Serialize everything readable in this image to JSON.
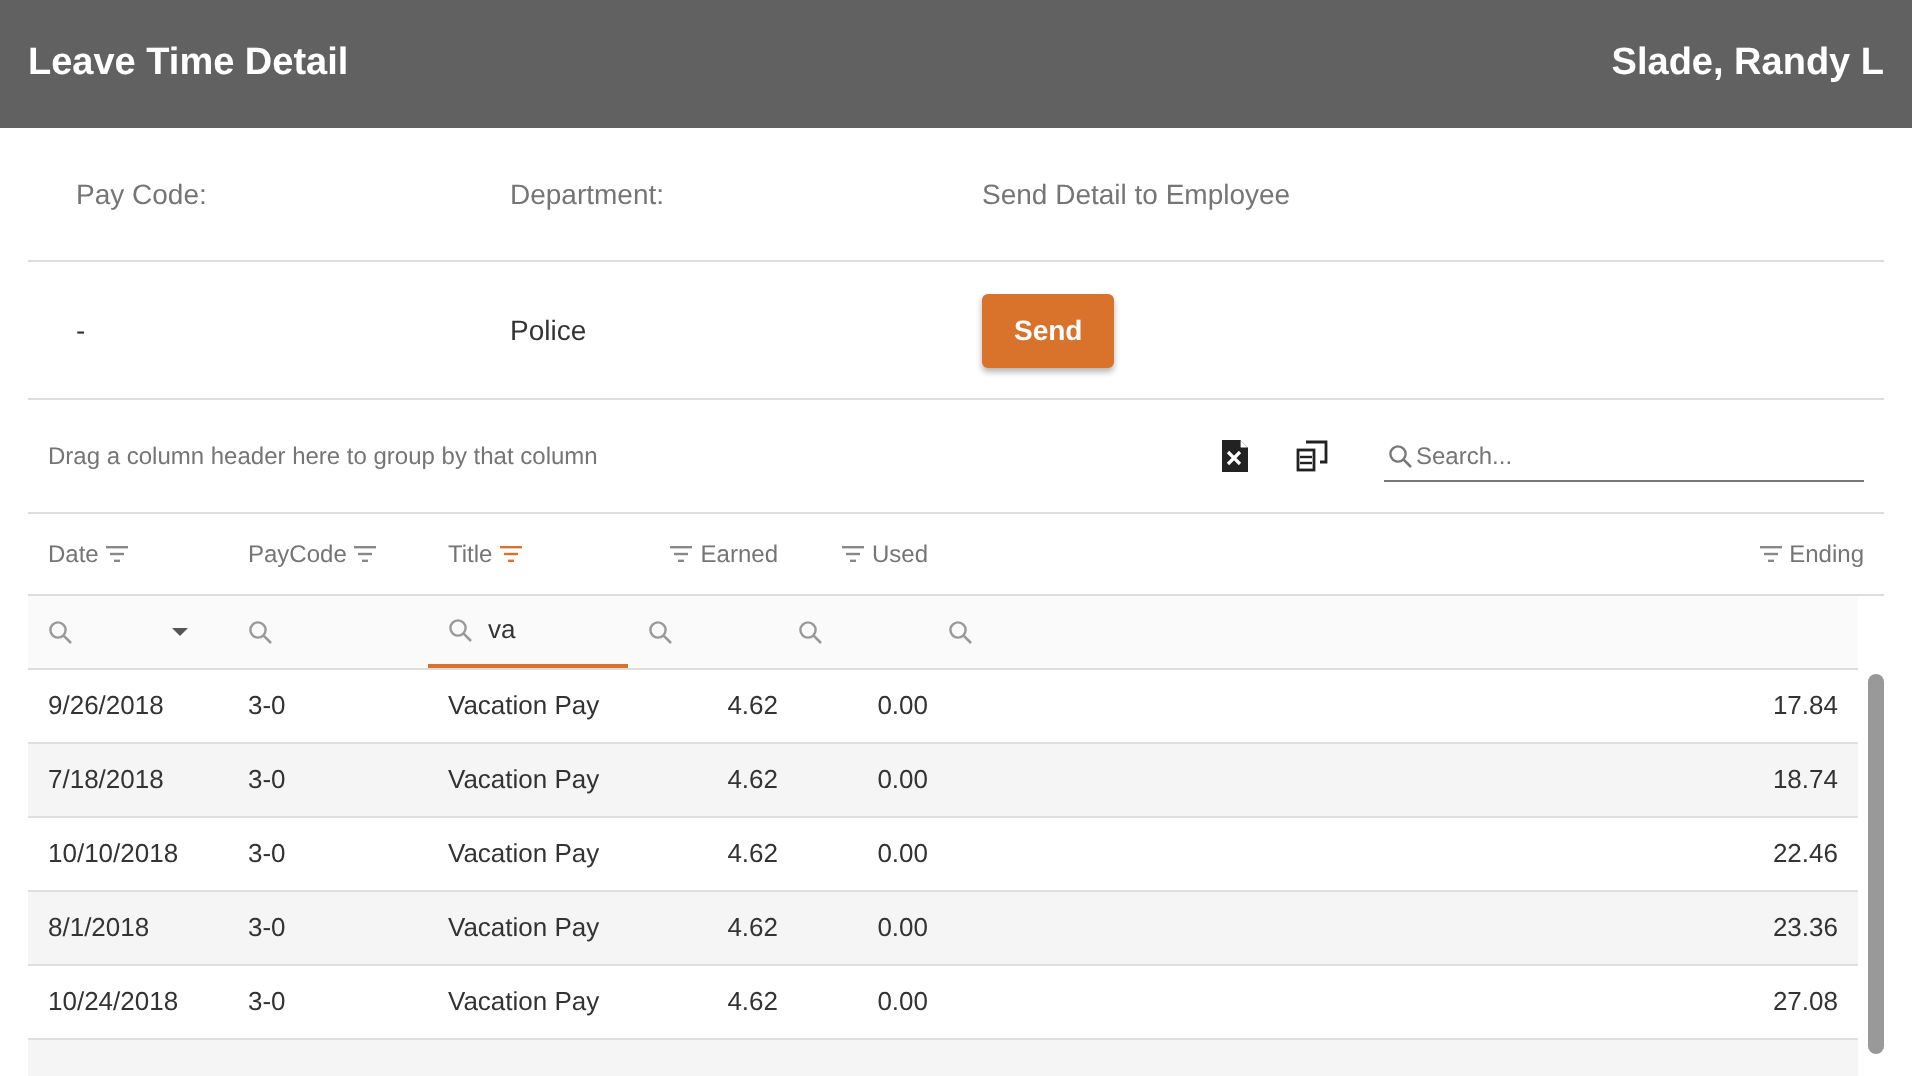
{
  "header": {
    "title": "Leave Time Detail",
    "employee": "Slade, Randy L"
  },
  "info": {
    "labels": [
      "Pay Code:",
      "Department:",
      "Send Detail to Employee"
    ],
    "values": [
      "-",
      "Police"
    ],
    "send_button": "Send"
  },
  "toolbar": {
    "group_hint": "Drag a column header here to group by that column",
    "search": {
      "placeholder": "Search..."
    }
  },
  "columns": [
    {
      "label": "Date",
      "filtered": false
    },
    {
      "label": "PayCode",
      "filtered": false
    },
    {
      "label": "Title",
      "filtered": true
    },
    {
      "label": "Earned",
      "filtered": false
    },
    {
      "label": "Used",
      "filtered": false
    },
    {
      "label": "Ending",
      "filtered": false
    }
  ],
  "filters": [
    {
      "kind": "dropdown",
      "focused": false
    },
    {
      "kind": "text",
      "focused": false
    },
    {
      "kind": "text",
      "value": "va",
      "focused": true
    },
    {
      "kind": "text",
      "focused": false
    },
    {
      "kind": "text",
      "focused": false
    },
    {
      "kind": "text",
      "focused": false
    }
  ],
  "rows": [
    [
      "9/26/2018",
      "3-0",
      "Vacation Pay",
      "4.62",
      "0.00",
      "17.84"
    ],
    [
      "7/18/2018",
      "3-0",
      "Vacation Pay",
      "4.62",
      "0.00",
      "18.74"
    ],
    [
      "10/10/2018",
      "3-0",
      "Vacation Pay",
      "4.62",
      "0.00",
      "22.46"
    ],
    [
      "8/1/2018",
      "3-0",
      "Vacation Pay",
      "4.62",
      "0.00",
      "23.36"
    ],
    [
      "10/24/2018",
      "3-0",
      "Vacation Pay",
      "4.62",
      "0.00",
      "27.08"
    ]
  ]
}
